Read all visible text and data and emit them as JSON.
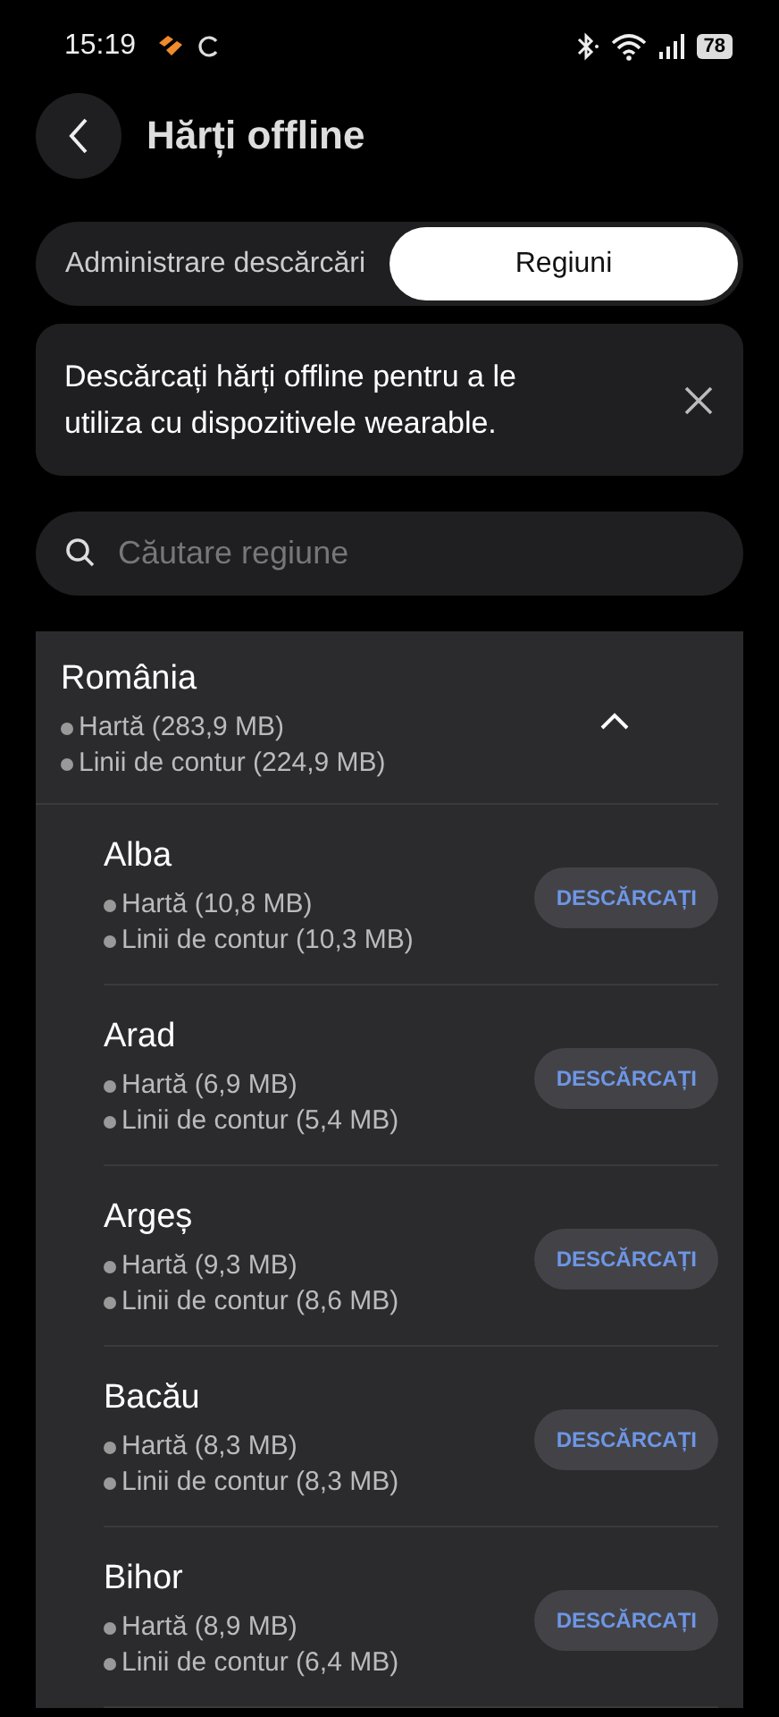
{
  "status_bar": {
    "time": "15:19",
    "battery": "78"
  },
  "header": {
    "title": "Hărți offline"
  },
  "tabs": [
    {
      "label": "Administrare descărcări",
      "selected": false
    },
    {
      "label": "Regiuni",
      "selected": true
    }
  ],
  "banner": {
    "text": "Descărcați hărți offline pentru a le utiliza cu dispozitivele wearable."
  },
  "search": {
    "placeholder": "Căutare regiune"
  },
  "country": {
    "name": "România",
    "expanded": true,
    "details": [
      "Hartă (283,9 MB)",
      "Linii de contur (224,9 MB)"
    ],
    "regions": [
      {
        "name": "Alba",
        "details": [
          "Hartă (10,8 MB)",
          "Linii de contur (10,3 MB)"
        ],
        "button": "DESCĂRCAȚI"
      },
      {
        "name": "Arad",
        "details": [
          "Hartă (6,9 MB)",
          "Linii de contur (5,4 MB)"
        ],
        "button": "DESCĂRCAȚI"
      },
      {
        "name": "Argeș",
        "details": [
          "Hartă (9,3 MB)",
          "Linii de contur (8,6 MB)"
        ],
        "button": "DESCĂRCAȚI"
      },
      {
        "name": "Bacău",
        "details": [
          "Hartă (8,3 MB)",
          "Linii de contur (8,3 MB)"
        ],
        "button": "DESCĂRCAȚI"
      },
      {
        "name": "Bihor",
        "details": [
          "Hartă (8,9 MB)",
          "Linii de contur (6,4 MB)"
        ],
        "button": "DESCĂRCAȚI"
      }
    ]
  }
}
